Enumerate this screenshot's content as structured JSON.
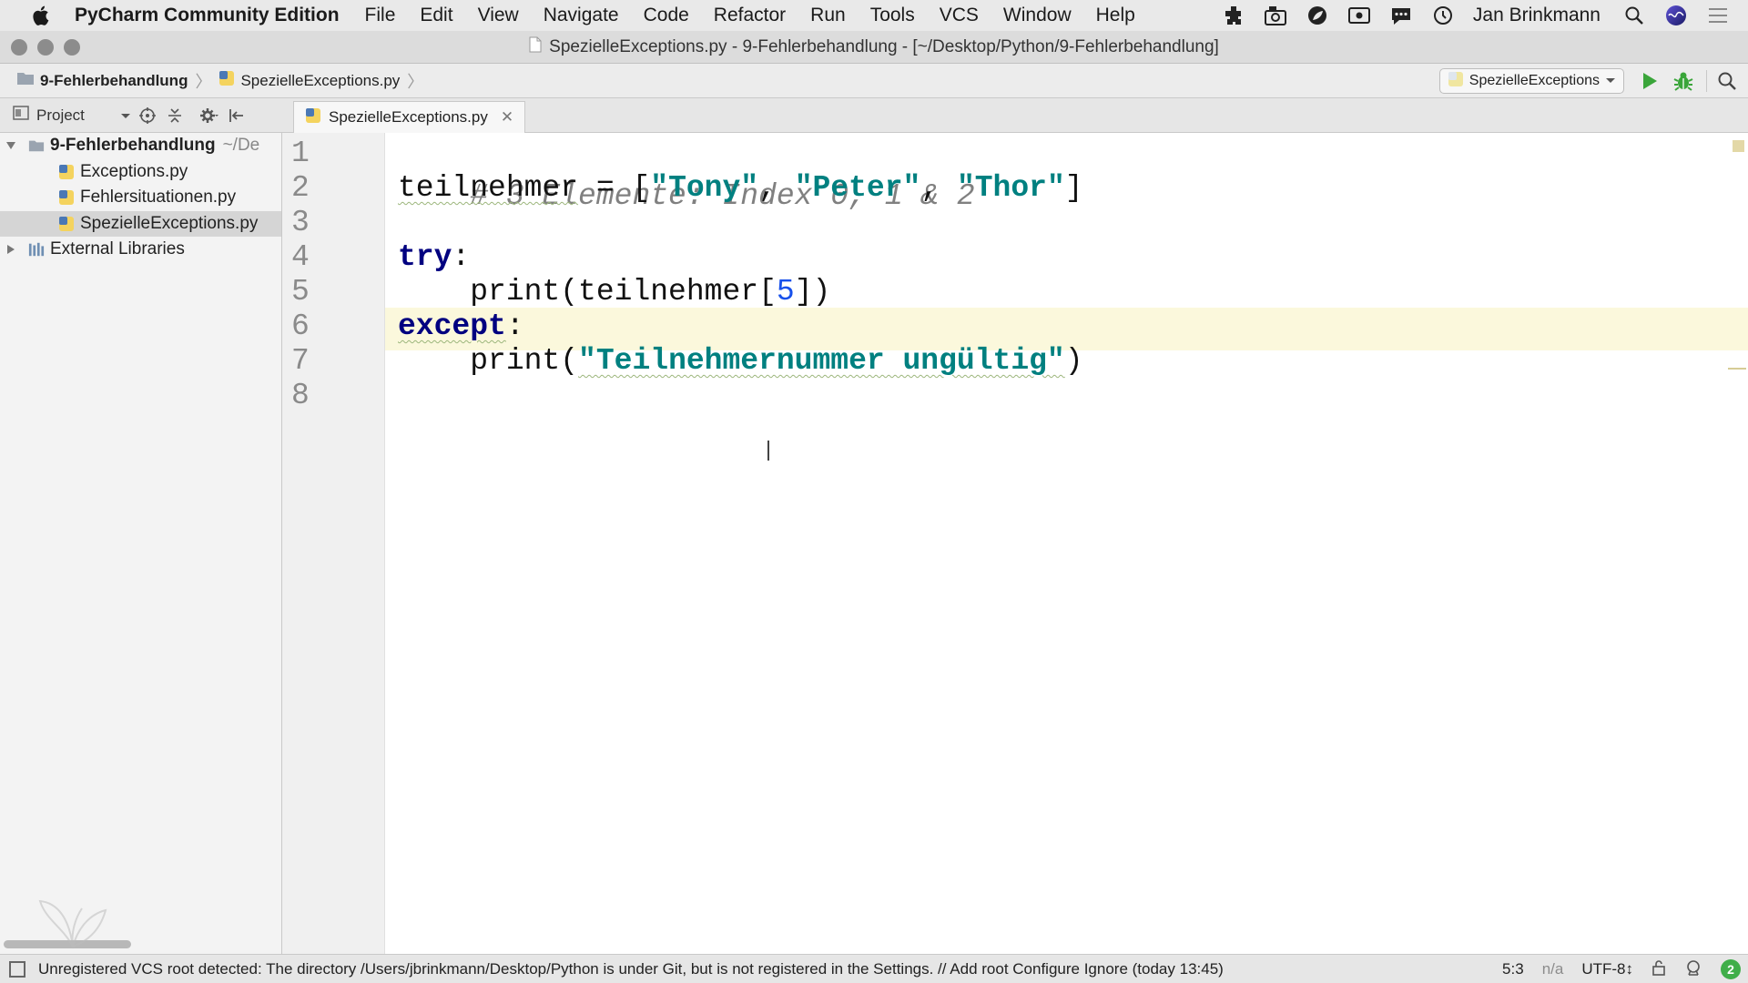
{
  "menubar": {
    "app_name": "PyCharm Community Edition",
    "items": [
      "File",
      "Edit",
      "View",
      "Navigate",
      "Code",
      "Refactor",
      "Run",
      "Tools",
      "VCS",
      "Window",
      "Help"
    ],
    "user": "Jan Brinkmann",
    "tray_icons": [
      "puzzle-icon",
      "camera-icon",
      "leaf-icon",
      "screen-record-icon",
      "chat-icon",
      "time-machine-icon",
      "spotlight-search-icon",
      "siri-icon",
      "notification-list-icon"
    ]
  },
  "window": {
    "title": "SpezielleExceptions.py - 9-Fehlerbehandlung - [~/Desktop/Python/9-Fehlerbehandlung]"
  },
  "navbar": {
    "breadcrumbs": [
      "9-Fehlerbehandlung",
      "SpezielleExceptions.py"
    ],
    "run_config": "SpezielleExceptions"
  },
  "project_panel": {
    "title": "Project",
    "root": {
      "name": "9-Fehlerbehandlung",
      "path": "~/De"
    },
    "files": [
      {
        "name": "Exceptions.py"
      },
      {
        "name": "Fehlersituationen.py"
      },
      {
        "name": "SpezielleExceptions.py",
        "selected": true
      }
    ],
    "external": "External Libraries"
  },
  "editor": {
    "tab_label": "SpezielleExceptions.py",
    "current_line": 5,
    "line_numbers": [
      "1",
      "2",
      "3",
      "4",
      "5",
      "6",
      "7",
      "8"
    ],
    "code": {
      "l1": "# 3 Elemente: Index 0, 1 & 2",
      "l2_var": "teilnehmer",
      "l2_eq": " = [",
      "l2_s1": "\"Tony\"",
      "l2_c1": ", ",
      "l2_s2": "\"Peter\"",
      "l2_c2": ", ",
      "l2_s3": "\"Thor\"",
      "l2_end": "]",
      "l4_kw": "try",
      "l4_colon": ":",
      "l5_pre": "    print(teilnehmer[",
      "l5_num": "5",
      "l5_post": "])",
      "l6_kw": "except",
      "l6_colon": ":",
      "l7_pre": "    print(",
      "l7_str": "\"Teilnehmernummer ungültig\"",
      "l7_post": ")"
    }
  },
  "statusbar": {
    "message": "Unregistered VCS root detected: The directory /Users/jbrinkmann/Desktop/Python is under Git, but is not registered in the Settings. // Add root  Configure  Ignore (today 13:45)",
    "position": "5:3",
    "na": "n/a",
    "encoding": "UTF-8↕",
    "badge": "2"
  },
  "colors": {
    "keyword": "#000080",
    "string": "#008080",
    "comment": "#808080",
    "current_line": "#fbf8dc",
    "run_green": "#3aa53a"
  }
}
